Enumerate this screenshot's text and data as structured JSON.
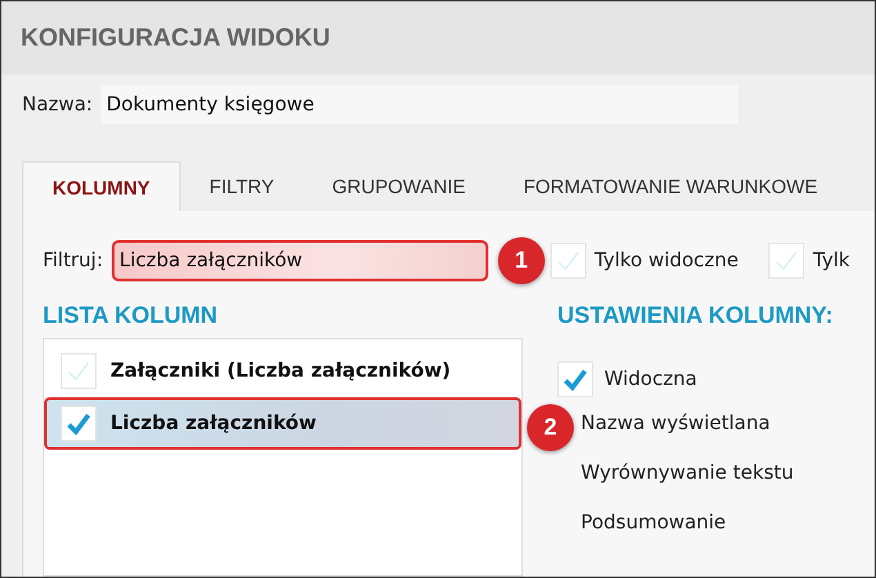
{
  "window": {
    "title": "KONFIGURACJA WIDOKU"
  },
  "name_field": {
    "label": "Nazwa:",
    "value": "Dokumenty księgowe"
  },
  "tabs": [
    {
      "label": "KOLUMNY",
      "selected": true
    },
    {
      "label": "FILTRY",
      "selected": false
    },
    {
      "label": "GRUPOWANIE",
      "selected": false
    },
    {
      "label": "FORMATOWANIE WARUNKOWE",
      "selected": false
    }
  ],
  "filter": {
    "label": "Filtruj:",
    "value": "Liczba załączników",
    "callout": "1"
  },
  "filter_options": [
    {
      "label": "Tylko widoczne",
      "checked": false
    },
    {
      "label": "Tylk",
      "checked": false
    }
  ],
  "column_list": {
    "heading": "LISTA KOLUMN",
    "items": [
      {
        "label": "Załączniki (Liczba załączników)",
        "checked": false,
        "selected": false
      },
      {
        "label": "Liczba załączników",
        "checked": true,
        "selected": true,
        "callout": "2"
      }
    ]
  },
  "column_settings": {
    "heading": "USTAWIENIA KOLUMNY:",
    "visible": {
      "label": "Widoczna",
      "checked": true
    },
    "fields": [
      "Nazwa wyświetlana",
      "Wyrównywanie tekstu",
      "Podsumowanie"
    ]
  }
}
